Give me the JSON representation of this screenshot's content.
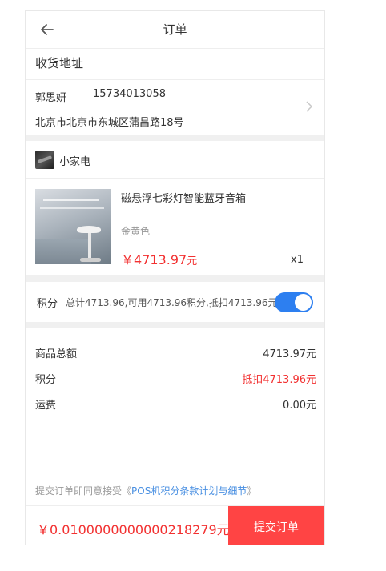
{
  "header": {
    "title": "订单"
  },
  "address_section": {
    "title": "收货地址",
    "name": "郭思妍",
    "phone": "15734013058",
    "address": "北京市北京市东城区蒲昌路18号"
  },
  "shop": {
    "name": "小家电"
  },
  "product": {
    "name": "磁悬浮七彩灯智能蓝牙音箱",
    "spec": "金黄色",
    "price_symbol": "￥",
    "price": "4713.97",
    "price_unit": "元",
    "quantity": "x1"
  },
  "points": {
    "label": "积分",
    "description": "总计4713.96,可用4713.96积分,抵扣4713.96元",
    "enabled": true
  },
  "summary": {
    "rows": [
      {
        "label": "商品总额",
        "value": "4713.97元"
      },
      {
        "label": "积分",
        "value": "抵扣4713.96元"
      },
      {
        "label": "运费",
        "value": "0.00元"
      }
    ]
  },
  "terms": {
    "prefix": "提交订单即同意接受《",
    "link": "POS机积分条款计划与细节",
    "suffix": "》"
  },
  "footer": {
    "total": "￥0.0100000000000218279元",
    "submit_label": "提交订单"
  },
  "colors": {
    "accent_red": "#f23030",
    "submit_bg": "#ff4444",
    "toggle_blue": "#2d7ff0",
    "link_blue": "#4a90e2"
  },
  "icons": {
    "back": "arrow-left-icon",
    "address_chevron": "chevron-right-icon"
  }
}
